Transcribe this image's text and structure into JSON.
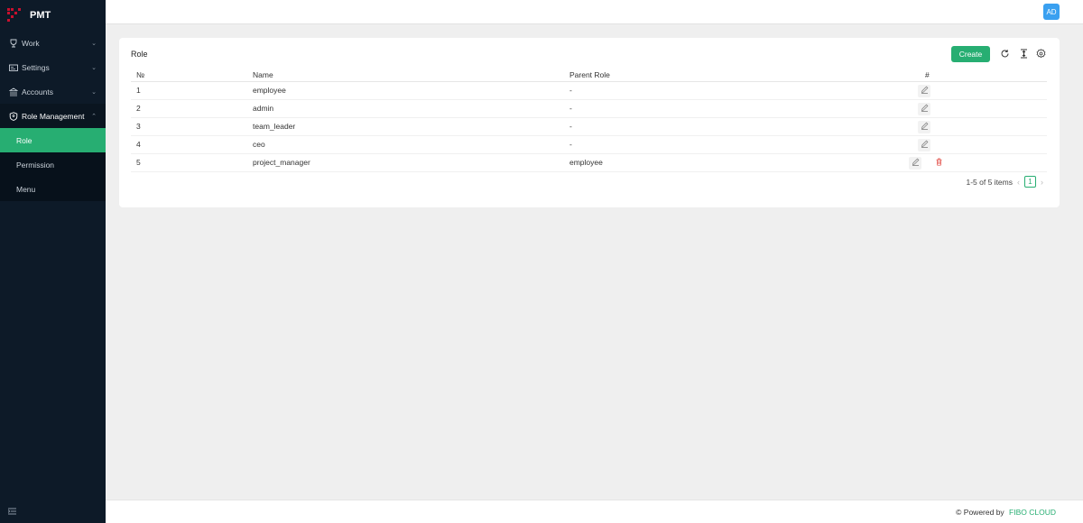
{
  "app": {
    "name": "PMT",
    "user_initials": "AD"
  },
  "sidebar": {
    "items": [
      {
        "label": "Work",
        "icon": "trophy-icon"
      },
      {
        "label": "Settings",
        "icon": "settings-card-icon"
      },
      {
        "label": "Accounts",
        "icon": "bank-icon"
      },
      {
        "label": "Role Management",
        "icon": "shield-icon"
      }
    ],
    "sub_items": [
      {
        "label": "Role",
        "active": true
      },
      {
        "label": "Permission"
      },
      {
        "label": "Menu"
      }
    ]
  },
  "page": {
    "title": "Role",
    "create_label": "Create",
    "columns": [
      "№",
      "Name",
      "Parent Role",
      "#"
    ],
    "rows": [
      {
        "no": "1",
        "name": "employee",
        "parent": "-",
        "deletable": false
      },
      {
        "no": "2",
        "name": "admin",
        "parent": "-",
        "deletable": false
      },
      {
        "no": "3",
        "name": "team_leader",
        "parent": "-",
        "deletable": false
      },
      {
        "no": "4",
        "name": "ceo",
        "parent": "-",
        "deletable": false
      },
      {
        "no": "5",
        "name": "project_manager",
        "parent": "employee",
        "deletable": true
      }
    ],
    "pagination": {
      "summary": "1-5 of 5 items",
      "current_page": "1"
    }
  },
  "footer": {
    "powered_prefix": "© Powered by",
    "powered_brand": "FIBO CLOUD"
  },
  "colors": {
    "accent": "#27ae72",
    "sidebar_bg": "#0d1a28",
    "avatar": "#3aa0f0",
    "danger": "#e0413a",
    "logo": "#c8102e"
  }
}
